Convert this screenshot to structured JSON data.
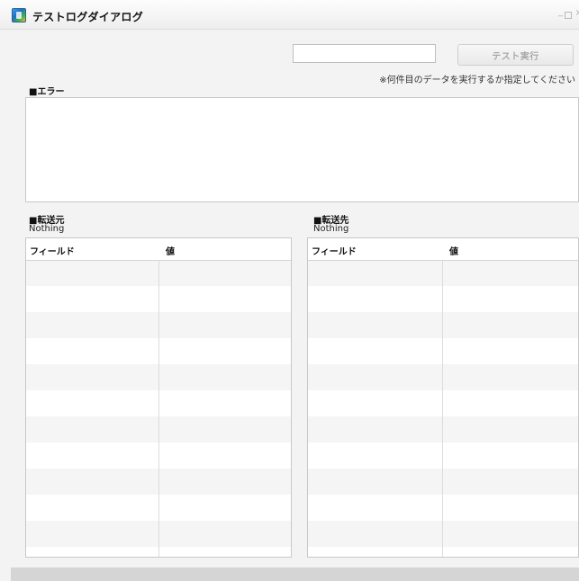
{
  "window": {
    "title": "テストログダイアログ",
    "controls": {
      "minimize": "_",
      "close": "×"
    }
  },
  "test": {
    "input_value": "",
    "button_label": "テスト実行",
    "hint": "※何件目のデータを実行するか指定してください"
  },
  "error": {
    "label": "■エラー",
    "text": ""
  },
  "source": {
    "label": "■転送元",
    "status": "Nothing",
    "columns": [
      "フィールド",
      "値"
    ],
    "rows": []
  },
  "destination": {
    "label": "■転送先",
    "status": "Nothing",
    "columns": [
      "フィールド",
      "値"
    ],
    "rows": []
  }
}
